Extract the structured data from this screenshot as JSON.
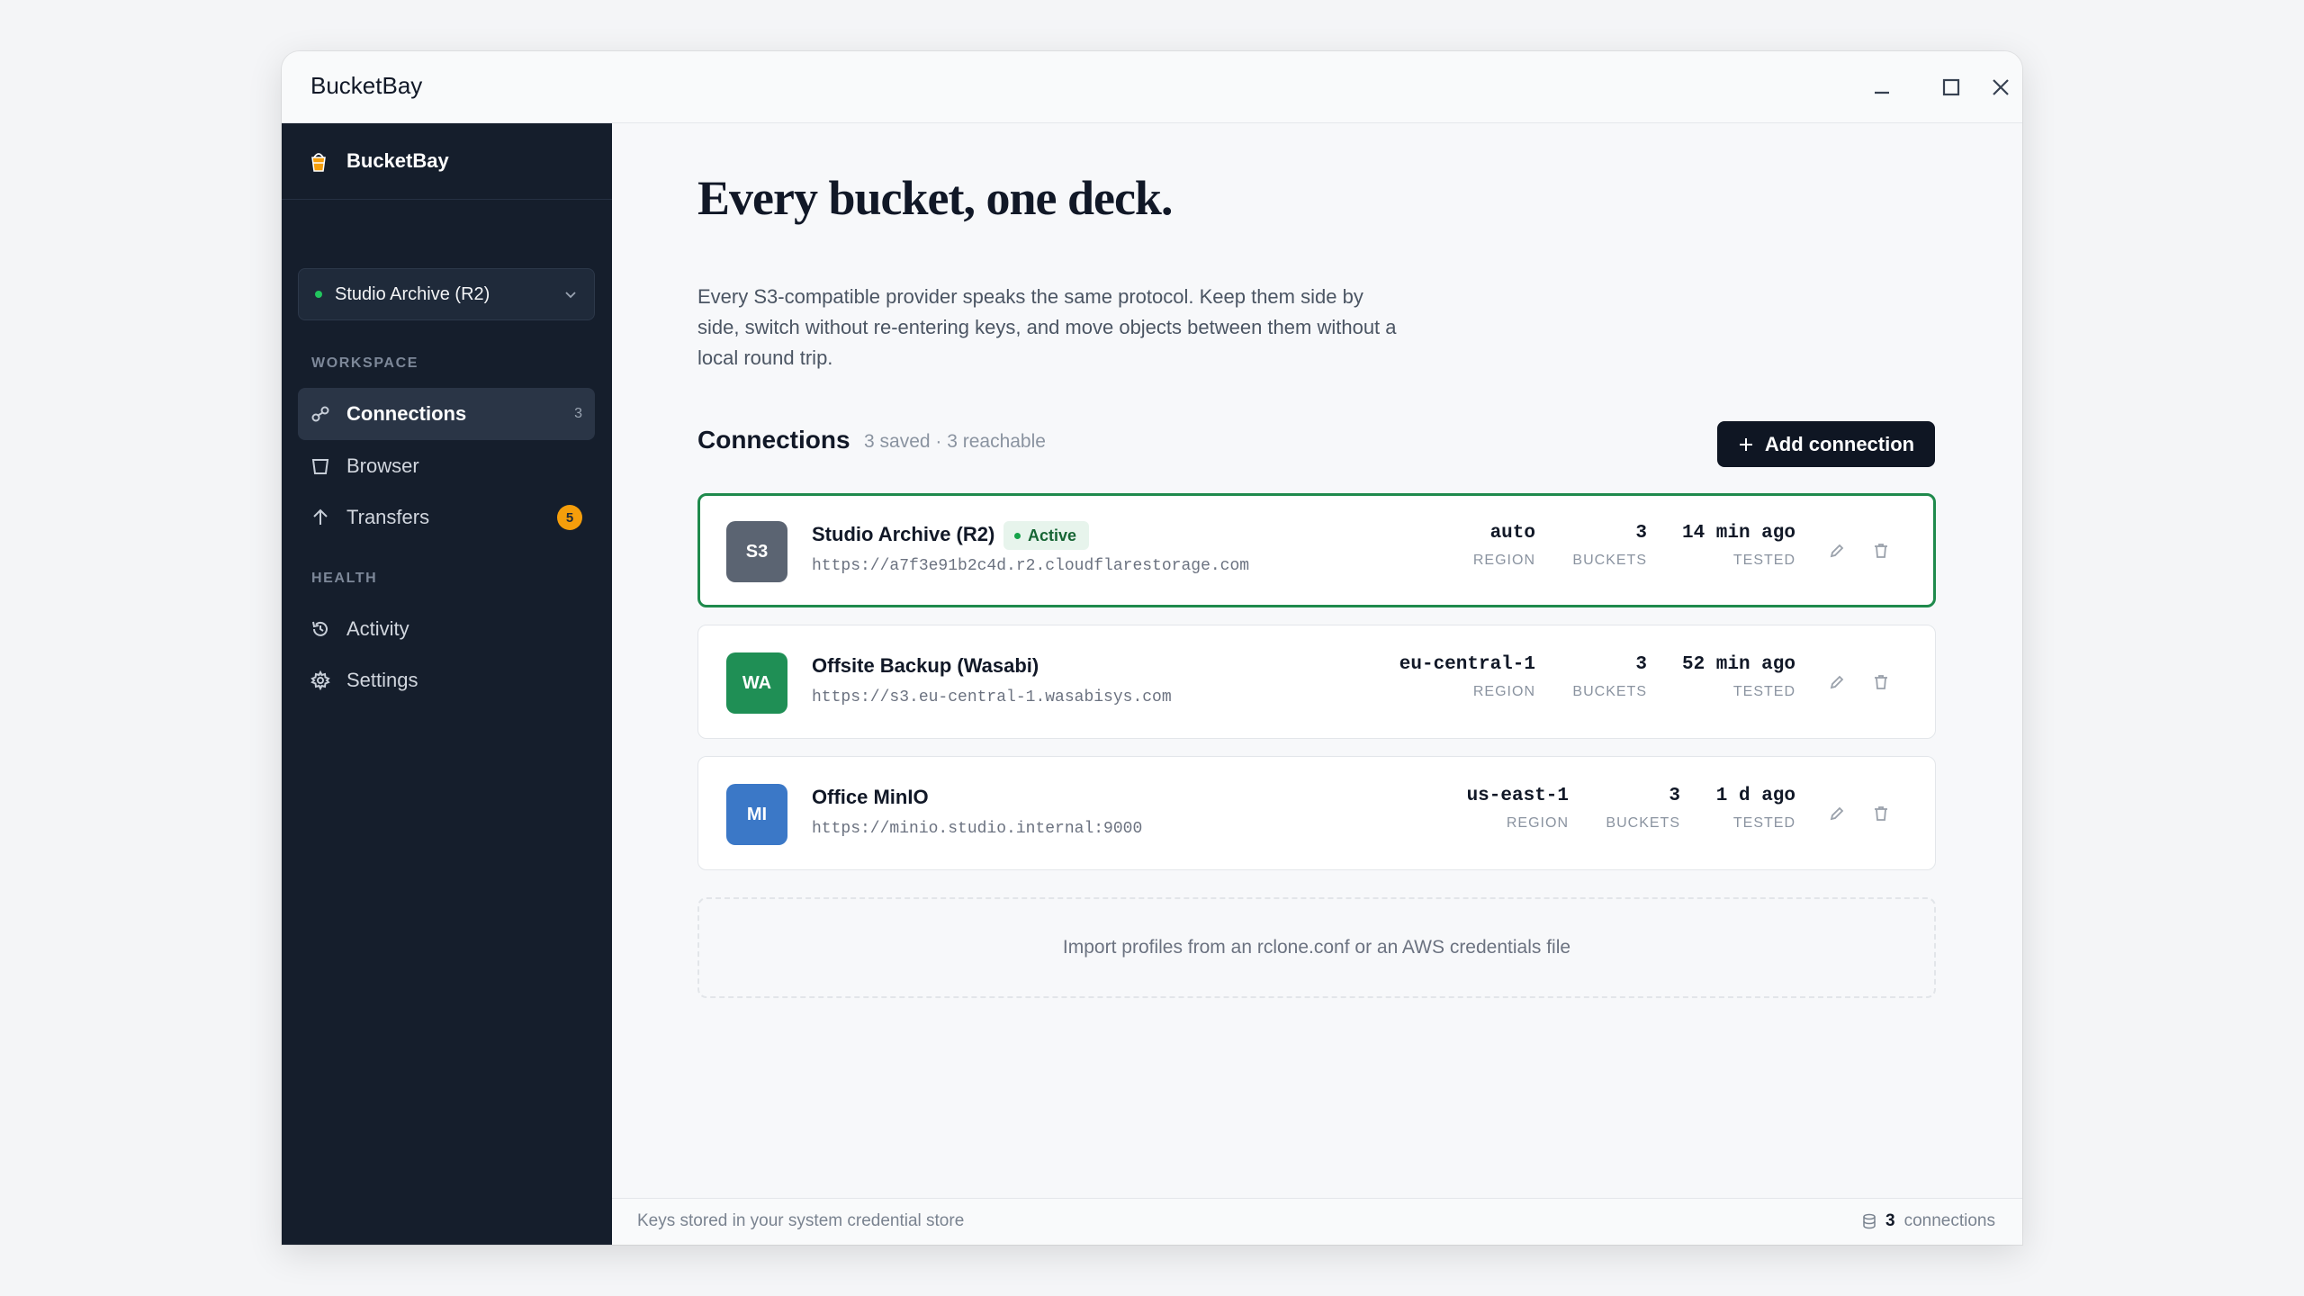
{
  "window": {
    "title": "BucketBay"
  },
  "sidebar": {
    "brand": "BucketBay",
    "workspace_select": {
      "value": "Studio Archive (R2)",
      "status_color": "#22c55e"
    },
    "sections": {
      "workspace": "WORKSPACE",
      "health": "HEALTH"
    },
    "items": [
      {
        "label": "Connections",
        "icon": "link-icon",
        "count": "3",
        "active": true
      },
      {
        "label": "Browser",
        "icon": "bucket-icon"
      },
      {
        "label": "Transfers",
        "icon": "arrow-up-icon",
        "badge": "5"
      },
      {
        "label": "Activity",
        "icon": "history-icon"
      },
      {
        "label": "Settings",
        "icon": "gear-icon"
      }
    ]
  },
  "hero": {
    "title": "Every bucket, one deck.",
    "description": "Every S3-compatible provider speaks the same protocol. Keep them side by side, switch without re-entering keys, and move objects between them without a local round trip."
  },
  "connections": {
    "heading": "Connections",
    "summary": "3 saved · 3 reachable",
    "add_button": "Add connection",
    "stat_labels": {
      "region": "REGION",
      "buckets": "BUCKETS",
      "tested": "TESTED"
    },
    "items": [
      {
        "initials": "S3",
        "name": "Studio Archive (R2)",
        "url": "https://a7f3e91b2c4d.r2.cloudflarestorage.com",
        "badge": "Active",
        "region": "auto",
        "buckets": "3",
        "tested": "14 min ago",
        "color": "#5b6472"
      },
      {
        "initials": "WA",
        "name": "Offsite Backup (Wasabi)",
        "url": "https://s3.eu-central-1.wasabisys.com",
        "region": "eu-central-1",
        "buckets": "3",
        "tested": "52 min ago",
        "color": "#1f8f55"
      },
      {
        "initials": "MI",
        "name": "Office MinIO",
        "url": "https://minio.studio.internal:9000",
        "region": "us-east-1",
        "buckets": "3",
        "tested": "1 d ago",
        "color": "#3b78c7"
      }
    ],
    "import_text": "Import profiles from an rclone.conf or an AWS credentials file"
  },
  "statusbar": {
    "left": "Keys stored in your system credential store",
    "count": "3",
    "count_label": "connections"
  },
  "colors": {
    "accent_active_border": "#1f8a4c",
    "sidebar_bg": "#151e2c",
    "primary_button": "#0f1623",
    "badge_orange": "#f59e0b"
  }
}
